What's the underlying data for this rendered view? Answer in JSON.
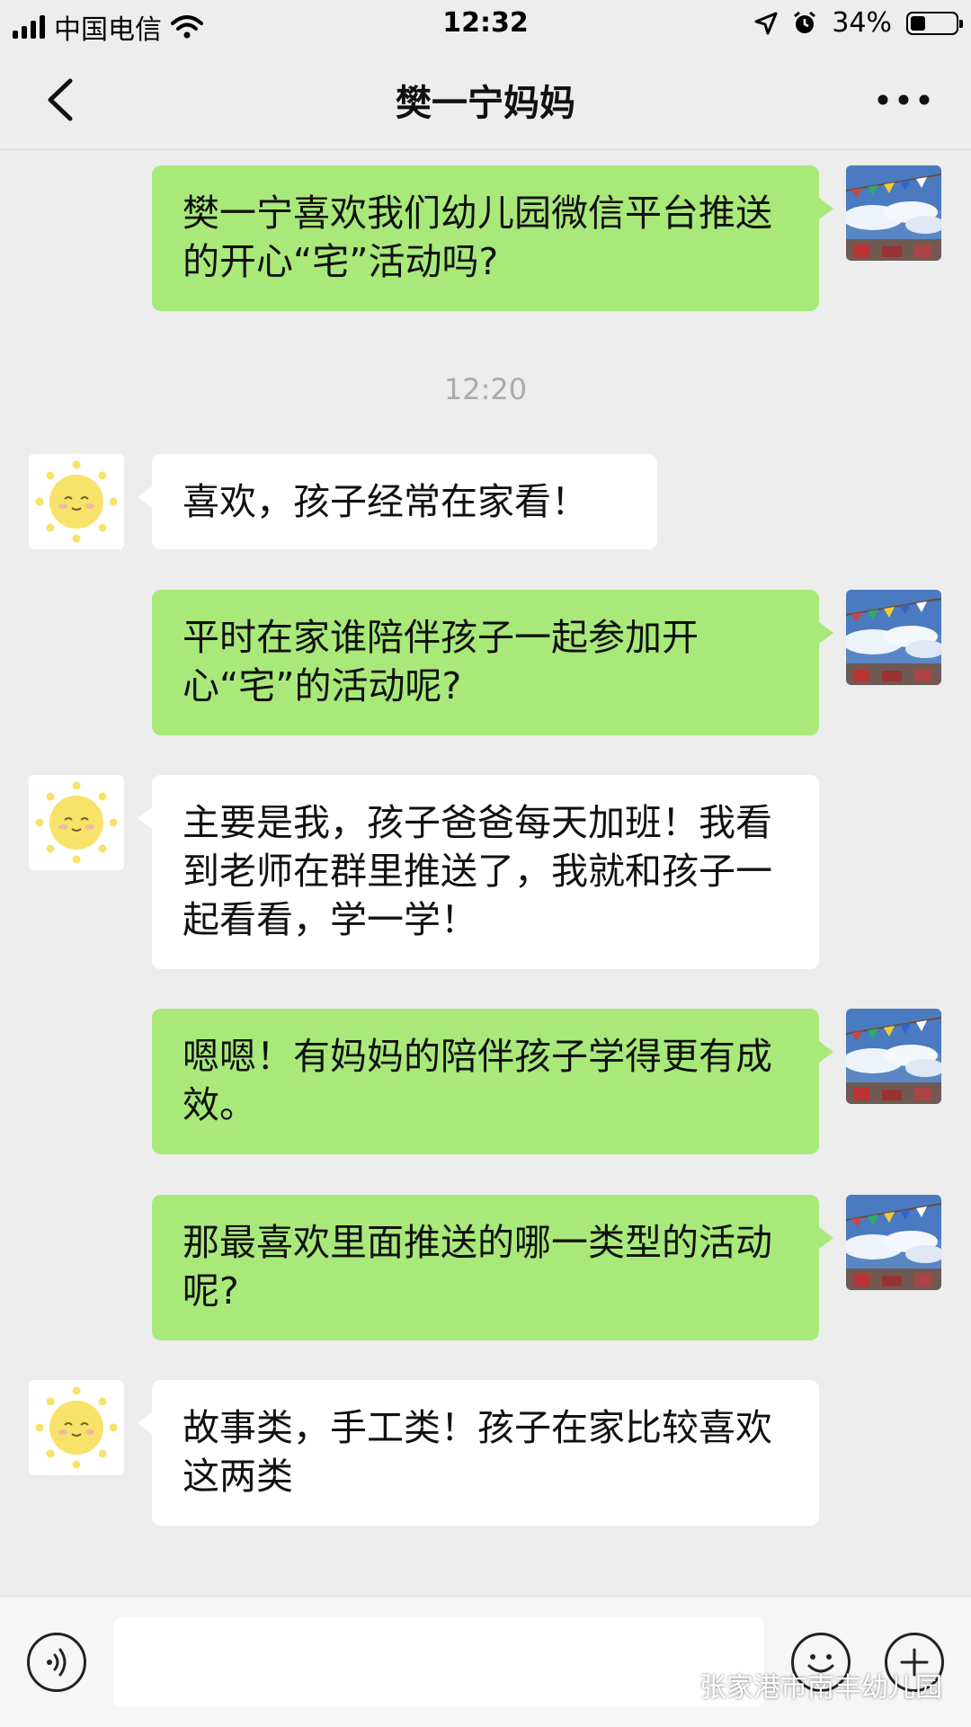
{
  "status_bar": {
    "carrier": "中国电信",
    "time": "12:32",
    "battery": "34%",
    "battery_level": 0.34
  },
  "nav": {
    "title": "樊一宁妈妈"
  },
  "messages": [
    {
      "side": "right",
      "text": "樊一宁喜欢我们幼儿园微信平台推送的开心“宅”活动吗?"
    },
    {
      "side": "center",
      "text": "12:20"
    },
    {
      "side": "left",
      "text": "喜欢，孩子经常在家看！"
    },
    {
      "side": "right",
      "text": "平时在家谁陪伴孩子一起参加开心“宅”的活动呢?"
    },
    {
      "side": "left",
      "text": "主要是我，孩子爸爸每天加班！我看到老师在群里推送了，我就和孩子一起看看，学一学！"
    },
    {
      "side": "right",
      "text": "嗯嗯！有妈妈的陪伴孩子学得更有成效。"
    },
    {
      "side": "right",
      "text": "那最喜欢里面推送的哪一类型的活动呢?"
    },
    {
      "side": "left",
      "text": "故事类，手工类！孩子在家比较喜欢这两类"
    }
  ],
  "input_bar": {
    "voice_icon": "voice-icon",
    "emoji_icon": "emoji-icon",
    "plus_icon": "plus-icon"
  },
  "watermark": {
    "text": "张家港市南丰幼儿园"
  },
  "colors": {
    "background": "#ededed",
    "outgoing_bubble": "#a9e97a",
    "incoming_bubble": "#ffffff"
  }
}
